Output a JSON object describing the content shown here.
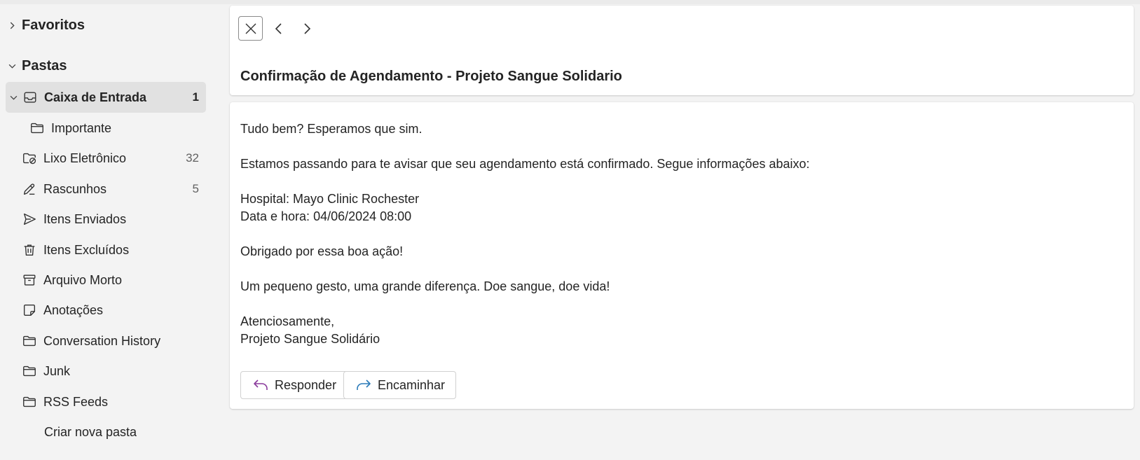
{
  "sidebar": {
    "favorites_label": "Favoritos",
    "folders_label": "Pastas",
    "items": [
      {
        "label": "Caixa de Entrada",
        "count": "1",
        "icon": "inbox-icon"
      },
      {
        "label": "Importante",
        "count": "",
        "icon": "folder-icon"
      },
      {
        "label": "Lixo Eletrônico",
        "count": "32",
        "icon": "junk-folder-icon"
      },
      {
        "label": "Rascunhos",
        "count": "5",
        "icon": "pencil-icon"
      },
      {
        "label": "Itens Enviados",
        "count": "",
        "icon": "send-icon"
      },
      {
        "label": "Itens Excluídos",
        "count": "",
        "icon": "trash-icon"
      },
      {
        "label": "Arquivo Morto",
        "count": "",
        "icon": "archive-icon"
      },
      {
        "label": "Anotações",
        "count": "",
        "icon": "note-icon"
      },
      {
        "label": "Conversation History",
        "count": "",
        "icon": "folder-icon"
      },
      {
        "label": "Junk",
        "count": "",
        "icon": "folder-icon"
      },
      {
        "label": "RSS Feeds",
        "count": "",
        "icon": "folder-icon"
      }
    ],
    "create_folder_label": "Criar nova pasta"
  },
  "message": {
    "subject": "Confirmação de Agendamento - Projeto Sangue Solidario",
    "body": {
      "greeting": "Tudo bem? Esperamos que sim.",
      "intro": "Estamos passando para te avisar que seu agendamento está confirmado. Segue informações abaixo:",
      "hospital": "Hospital: Mayo Clinic Rochester",
      "datetime": "Data e hora: 04/06/2024 08:00",
      "thanks": "Obrigado por essa boa ação!",
      "slogan": "Um pequeno gesto, uma grande diferença. Doe sangue, doe vida!",
      "closing": "Atenciosamente,",
      "signature": "Projeto Sangue Solidário"
    }
  },
  "actions": {
    "reply_label": "Responder",
    "forward_label": "Encaminhar"
  },
  "colors": {
    "reply_accent": "#8a3a9c",
    "forward_accent": "#2b7bb9",
    "selected_bg": "#e1e1e1",
    "page_bg": "#f3f3f3"
  }
}
